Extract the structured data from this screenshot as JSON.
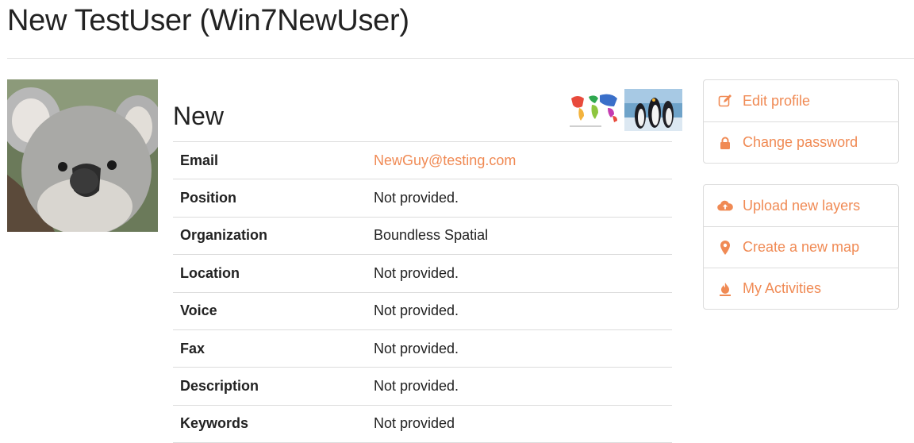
{
  "header": {
    "title": "New TestUser (Win7NewUser)"
  },
  "profile": {
    "name": "New",
    "details": [
      {
        "label": "Email",
        "value": "NewGuy@testing.com",
        "is_link": true
      },
      {
        "label": "Position",
        "value": "Not provided."
      },
      {
        "label": "Organization",
        "value": "Boundless Spatial"
      },
      {
        "label": "Location",
        "value": "Not provided."
      },
      {
        "label": "Voice",
        "value": "Not provided."
      },
      {
        "label": "Fax",
        "value": "Not provided."
      },
      {
        "label": "Description",
        "value": "Not provided."
      },
      {
        "label": "Keywords",
        "value": "Not provided"
      }
    ]
  },
  "account_menu": {
    "items": [
      {
        "label": "Edit profile",
        "icon": "edit-icon"
      },
      {
        "label": "Change password",
        "icon": "lock-icon"
      }
    ]
  },
  "actions_menu": {
    "items": [
      {
        "label": "Upload new layers",
        "icon": "cloud-upload-icon"
      },
      {
        "label": "Create a new map",
        "icon": "map-marker-icon"
      },
      {
        "label": "My Activities",
        "icon": "fire-icon"
      }
    ]
  },
  "colors": {
    "accent": "#f08a54",
    "border": "#dcdcdc",
    "text": "#222222"
  }
}
